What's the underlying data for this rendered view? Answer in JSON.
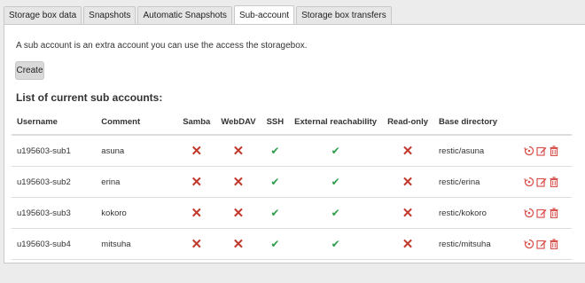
{
  "tabs": [
    {
      "label": "Storage box data"
    },
    {
      "label": "Snapshots"
    },
    {
      "label": "Automatic Snapshots"
    },
    {
      "label": "Sub-account"
    },
    {
      "label": "Storage box transfers"
    }
  ],
  "description": "A sub account is an extra account you can use the access the storagebox.",
  "create_label": "Create",
  "list_title": "List of current sub accounts:",
  "columns": {
    "username": "Username",
    "comment": "Comment",
    "samba": "Samba",
    "webdav": "WebDAV",
    "ssh": "SSH",
    "external": "External reachability",
    "readonly": "Read-only",
    "basedir": "Base directory"
  },
  "rows": [
    {
      "username": "u195603-sub1",
      "comment": "asuna",
      "samba": false,
      "webdav": false,
      "ssh": true,
      "external": true,
      "readonly": false,
      "basedir": "restic/asuna"
    },
    {
      "username": "u195603-sub2",
      "comment": "erina",
      "samba": false,
      "webdav": false,
      "ssh": true,
      "external": true,
      "readonly": false,
      "basedir": "restic/erina"
    },
    {
      "username": "u195603-sub3",
      "comment": "kokoro",
      "samba": false,
      "webdav": false,
      "ssh": true,
      "external": true,
      "readonly": false,
      "basedir": "restic/kokoro"
    },
    {
      "username": "u195603-sub4",
      "comment": "mitsuha",
      "samba": false,
      "webdav": false,
      "ssh": true,
      "external": true,
      "readonly": false,
      "basedir": "restic/mitsuha"
    }
  ],
  "icons": {
    "false": "cross-icon",
    "true": "check-icon",
    "actions": [
      "reset-password-icon",
      "edit-icon",
      "delete-icon"
    ]
  },
  "colors": {
    "cross": "#c0392b",
    "check": "#2e9e4b",
    "action": "#d9534f"
  }
}
